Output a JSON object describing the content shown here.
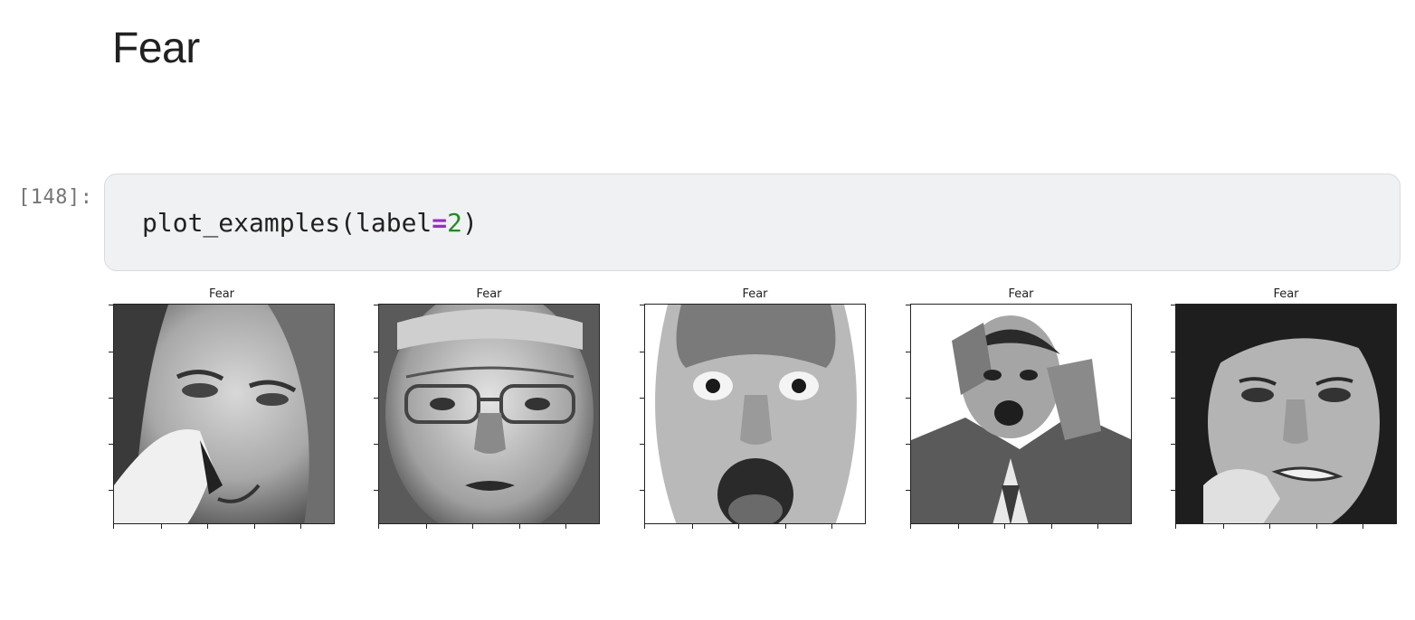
{
  "notebook": {
    "heading": "Fear",
    "cell": {
      "prompt": "[148]:",
      "code": {
        "fn": "plot_examples(label",
        "op": "=",
        "num": "2",
        "close": ")"
      }
    },
    "output": {
      "figures": [
        {
          "title": "Fear",
          "subject": "woman-pinching-nose"
        },
        {
          "title": "Fear",
          "subject": "older-man-with-glasses"
        },
        {
          "title": "Fear",
          "subject": "man-wide-eyes-open-mouth"
        },
        {
          "title": "Fear",
          "subject": "man-hands-on-head-screaming"
        },
        {
          "title": "Fear",
          "subject": "woman-biting-fingers"
        }
      ]
    }
  },
  "colors": {
    "heading": "#212121",
    "prompt": "#757575",
    "cell_bg": "#f0f1f3",
    "cell_border": "#d9dadd",
    "operator": "#9c27d9",
    "number": "#1f8c1f"
  }
}
